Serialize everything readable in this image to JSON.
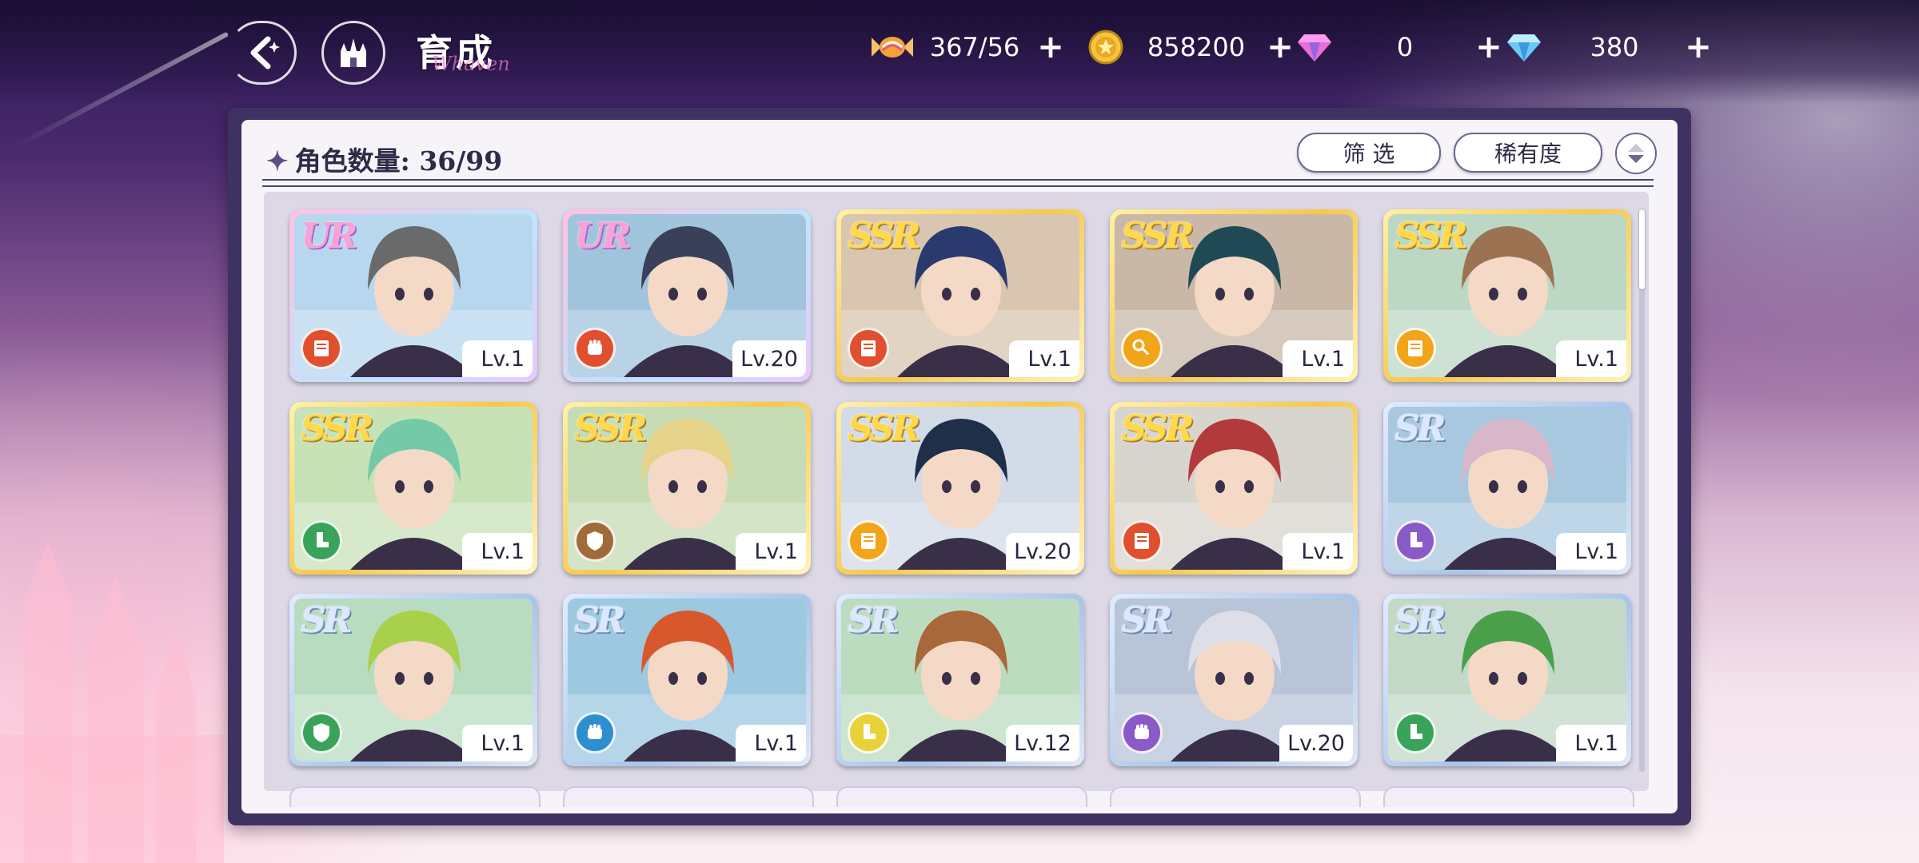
{
  "header": {
    "title": "育成",
    "title_script": "Whaven",
    "back_icon": "back-arrow-icon",
    "home_icon": "castle-home-icon"
  },
  "resources": [
    {
      "name": "candy",
      "icon": "candy-icon",
      "value": "367/56",
      "color": "#f2a33a"
    },
    {
      "name": "coin",
      "icon": "coin-icon",
      "value": "858200",
      "color": "#f5c542"
    },
    {
      "name": "pink-gem",
      "icon": "pink-gem-icon",
      "value": "0",
      "color": "#e56fd6"
    },
    {
      "name": "blue-gem",
      "icon": "blue-gem-icon",
      "value": "380",
      "color": "#7dd5ff"
    }
  ],
  "panel": {
    "title": "角色数量: 36/99",
    "filter_label": "筛 选",
    "sort_label": "稀有度"
  },
  "cards": [
    {
      "rarity": "UR",
      "tier": "ur",
      "level": "Lv.1",
      "role_icon": "book-icon",
      "role_color": "#e0502e",
      "hair": "#6a6a6a",
      "bg": "#b7d7ef"
    },
    {
      "rarity": "UR",
      "tier": "ur",
      "level": "Lv.20",
      "role_icon": "fist-icon",
      "role_color": "#e0502e",
      "hair": "#3a3f5a",
      "bg": "#9fc4dc"
    },
    {
      "rarity": "SSR",
      "tier": "ssr",
      "level": "Lv.1",
      "role_icon": "book-icon",
      "role_color": "#e0502e",
      "hair": "#2b3a6e",
      "bg": "#d9c6b0"
    },
    {
      "rarity": "SSR",
      "tier": "ssr",
      "level": "Lv.1",
      "role_icon": "key-icon",
      "role_color": "#f2a51a",
      "hair": "#1f4a55",
      "bg": "#c9b8a8"
    },
    {
      "rarity": "SSR",
      "tier": "ssr",
      "level": "Lv.1",
      "role_icon": "book-icon",
      "role_color": "#f2a51a",
      "hair": "#9b7352",
      "bg": "#bcd8c4"
    },
    {
      "rarity": "SSR",
      "tier": "ssr",
      "level": "Lv.1",
      "role_icon": "boot-icon",
      "role_color": "#3aa35a",
      "hair": "#74c9a9",
      "bg": "#c8e2b8"
    },
    {
      "rarity": "SSR",
      "tier": "ssr",
      "level": "Lv.1",
      "role_icon": "shield-icon",
      "role_color": "#a06a3a",
      "hair": "#e6d38a",
      "bg": "#c6dcb4"
    },
    {
      "rarity": "SSR",
      "tier": "ssr",
      "level": "Lv.20",
      "role_icon": "book-icon",
      "role_color": "#f2a51a",
      "hair": "#1f2f4a",
      "bg": "#d2dbe8"
    },
    {
      "rarity": "SSR",
      "tier": "ssr",
      "level": "Lv.1",
      "role_icon": "book-icon",
      "role_color": "#e0502e",
      "hair": "#b23a3a",
      "bg": "#d8d4ce"
    },
    {
      "rarity": "SR",
      "tier": "sr",
      "level": "Lv.1",
      "role_icon": "boot-icon",
      "role_color": "#8a5ac9",
      "hair": "#d8b8c8",
      "bg": "#a8c8e0"
    },
    {
      "rarity": "SR",
      "tier": "sr",
      "level": "Lv.1",
      "role_icon": "shield-icon",
      "role_color": "#3aa35a",
      "hair": "#a8d04a",
      "bg": "#b8dcc0"
    },
    {
      "rarity": "SR",
      "tier": "sr",
      "level": "Lv.1",
      "role_icon": "fist-icon",
      "role_color": "#2d8fd0",
      "hair": "#d8582e",
      "bg": "#9cc8e0"
    },
    {
      "rarity": "SR",
      "tier": "sr",
      "level": "Lv.12",
      "role_icon": "boot-icon",
      "role_color": "#e8d23a",
      "hair": "#a8683a",
      "bg": "#bcdcc0"
    },
    {
      "rarity": "SR",
      "tier": "sr",
      "level": "Lv.20",
      "role_icon": "fist-icon",
      "role_color": "#8a5ac9",
      "hair": "#dedee8",
      "bg": "#b8c4d8"
    },
    {
      "rarity": "SR",
      "tier": "sr",
      "level": "Lv.1",
      "role_icon": "boot-icon",
      "role_color": "#3aa35a",
      "hair": "#4aa04a",
      "bg": "#c4d8c8"
    }
  ]
}
